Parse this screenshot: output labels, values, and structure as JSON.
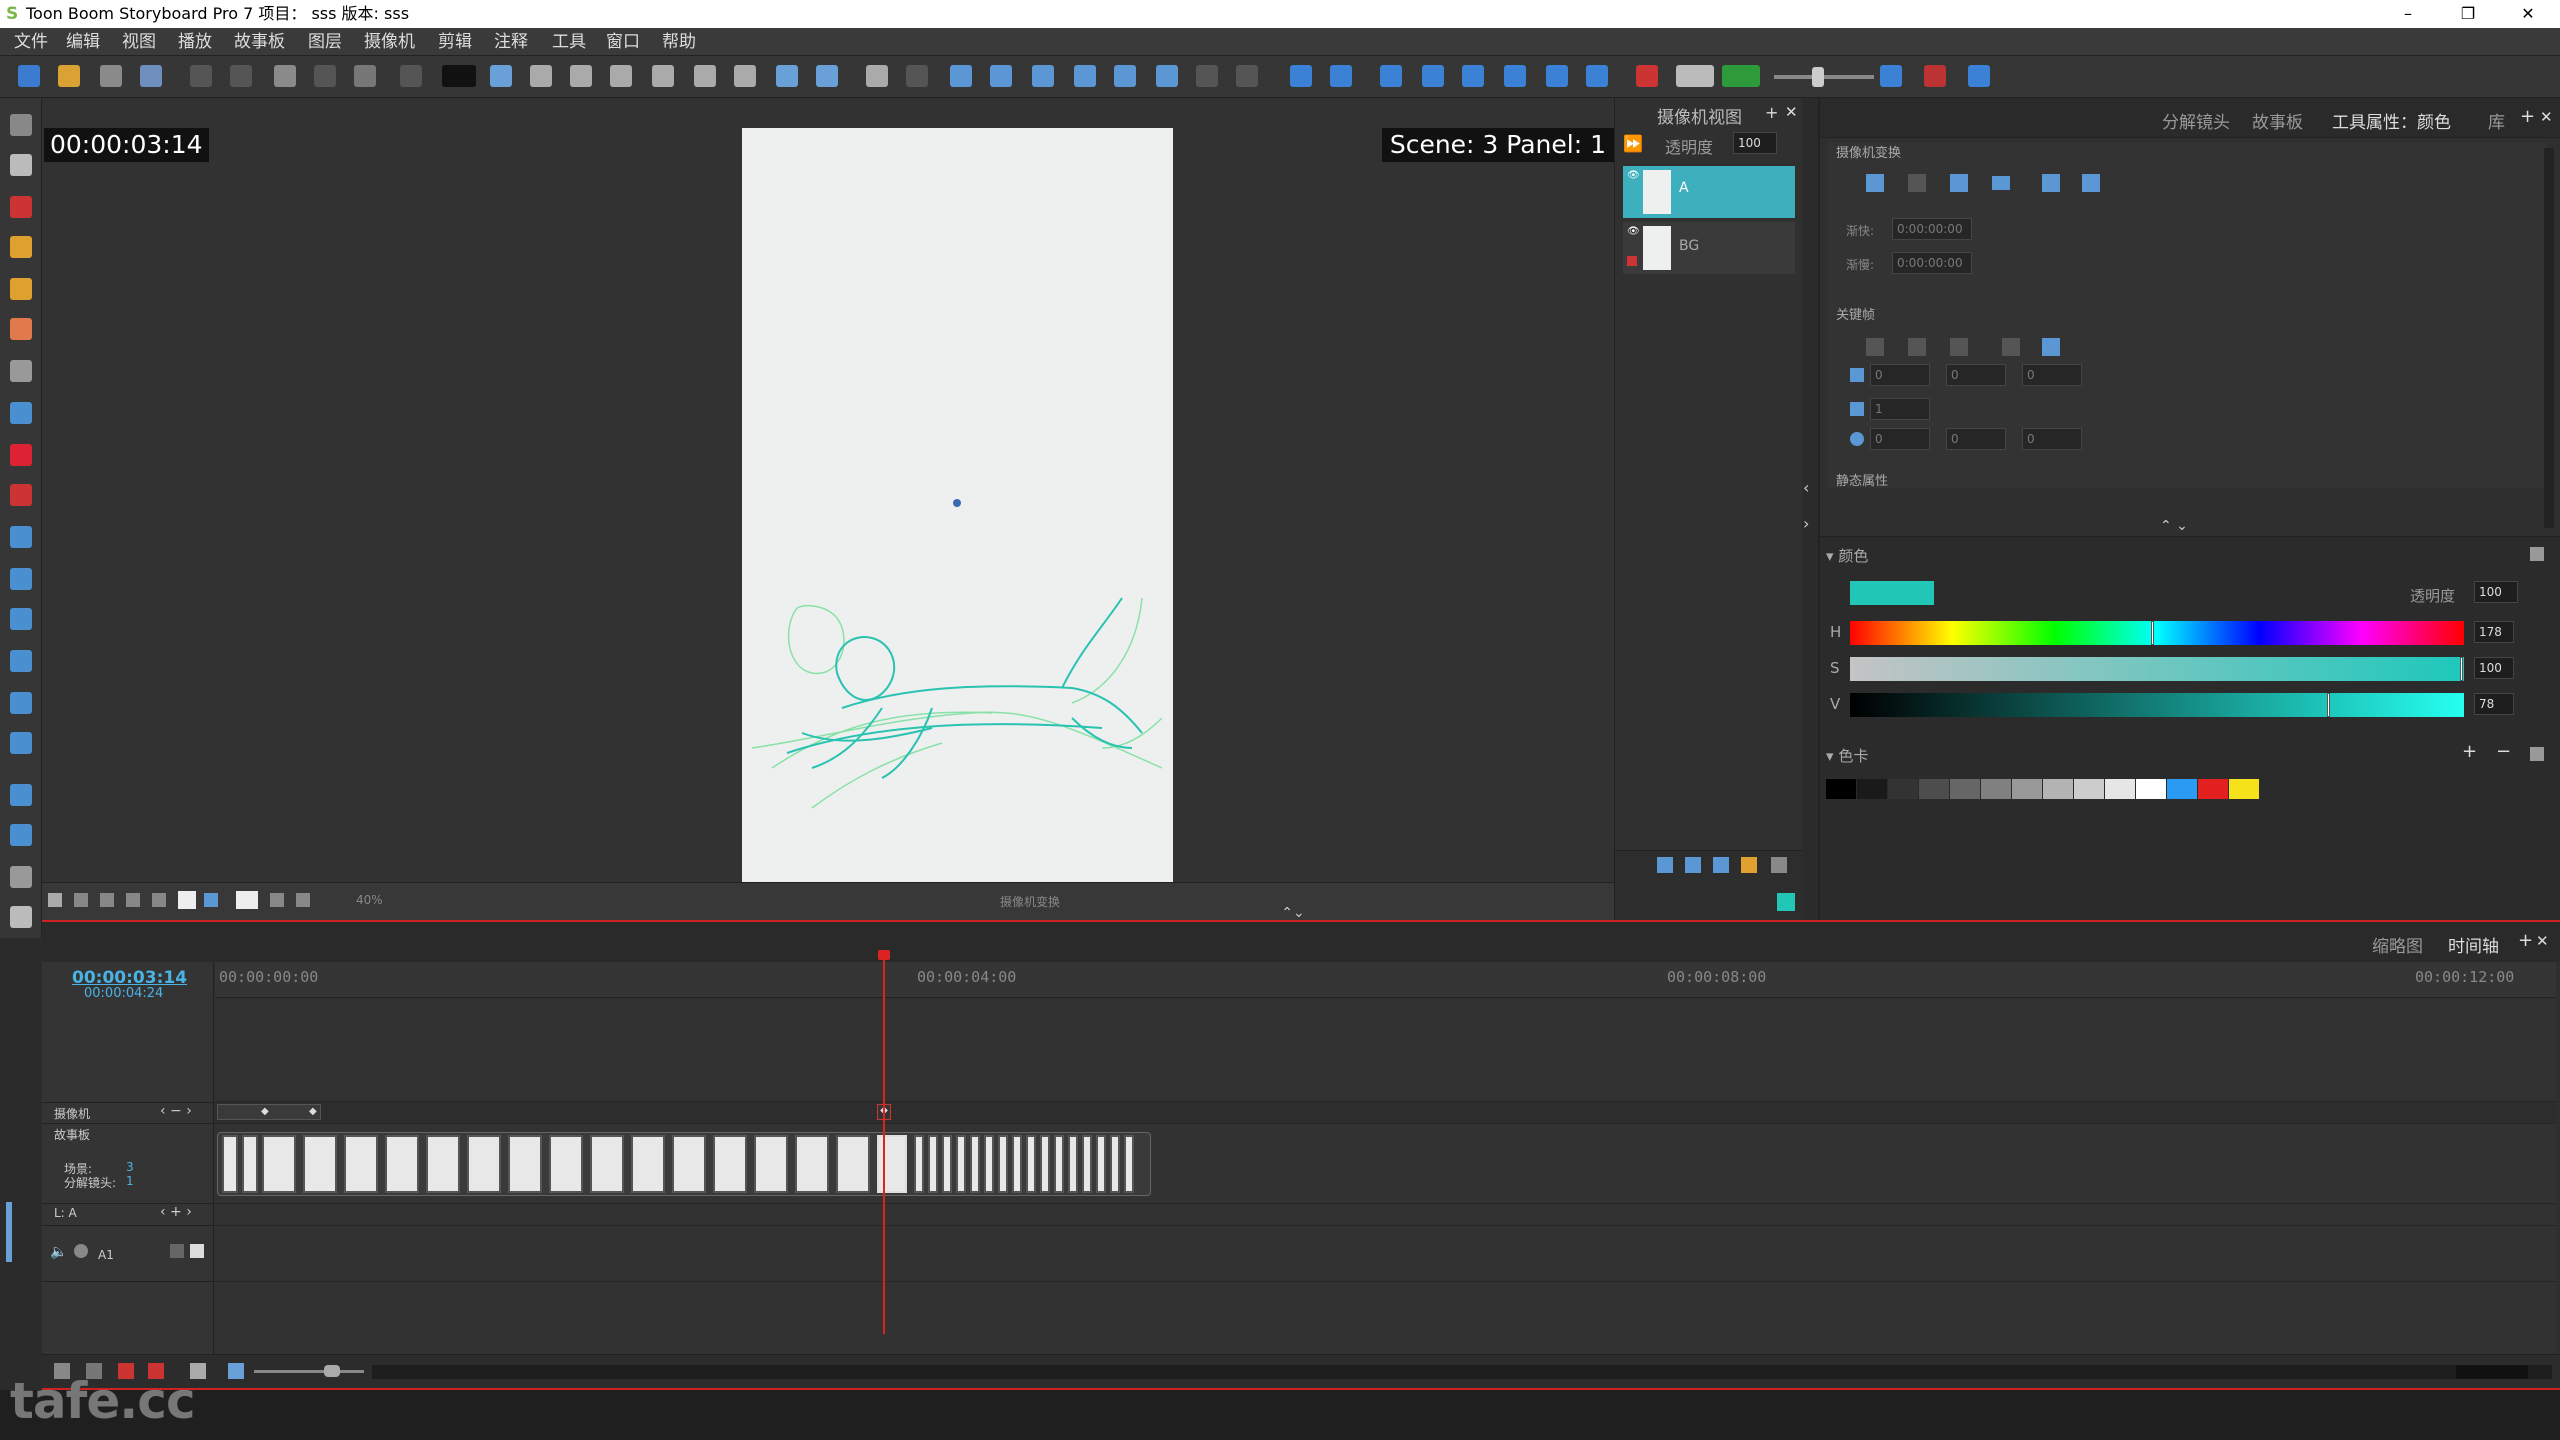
{
  "window": {
    "title": "Toon Boom Storyboard Pro 7 项目： sss 版本: sss",
    "min": "–",
    "max": "❐",
    "close": "✕"
  },
  "menu": [
    "文件",
    "编辑",
    "视图",
    "播放",
    "故事板",
    "图层",
    "摄像机",
    "剪辑",
    "注释",
    "工具",
    "窗口",
    "帮助"
  ],
  "viewer": {
    "timecode": "00:00:03:14",
    "scene_panel": "Scene: 3 Panel: 1",
    "zoom": "40%",
    "mode_label": "摄像机变换"
  },
  "camera_view": {
    "title": "摄像机视图",
    "opacity_label": "透明度",
    "opacity_value": "100",
    "layers": [
      {
        "name": "A",
        "selected": true
      },
      {
        "name": "BG",
        "selected": false
      }
    ]
  },
  "right_tabs": [
    "分解镜头",
    "故事板",
    "工具属性：颜色",
    "库"
  ],
  "tool_props": {
    "cam_transform_label": "摄像机变换",
    "ease_in_label": "渐快:",
    "ease_in_value": "0:00:00:00",
    "ease_out_label": "渐慢:",
    "ease_out_value": "0:00:00:00",
    "keyframe_label": "关键帧",
    "static_label": "静态属性",
    "pos_values": [
      "0",
      "0",
      "0"
    ],
    "scale_value": "1",
    "rot_values": [
      "0",
      "0",
      "0"
    ]
  },
  "color": {
    "section_label": "颜色",
    "opacity_label": "透明度",
    "opacity_value": "100",
    "current_color": "#22c6b7",
    "h_label": "H",
    "h_value": "178",
    "h_fraction": 0.494,
    "s_label": "S",
    "s_value": "100",
    "s_fraction": 1.0,
    "v_label": "V",
    "v_value": "78",
    "v_fraction": 0.78,
    "palette_label": "色卡",
    "palette": [
      "#000000",
      "#1a1a1a",
      "#333333",
      "#4d4d4d",
      "#666666",
      "#808080",
      "#999999",
      "#b3b3b3",
      "#cccccc",
      "#e6e6e6",
      "#ffffff",
      "#2b9af3",
      "#e32020",
      "#f5e21a"
    ]
  },
  "timeline": {
    "current_time": "00:00:03:14",
    "duration": "00:00:04:24",
    "tabs": [
      "缩略图",
      "时间轴"
    ],
    "ruler": [
      "00:00:00:00",
      "00:00:04:00",
      "00:00:08:00",
      "00:00:12:00"
    ],
    "camera_track": "摄像机",
    "storyboard_track": "故事板",
    "scene_label": "场景:",
    "scene_value": "3",
    "panel_label": "分解镜头:",
    "panel_value": "1",
    "layer_track": "L: A",
    "audio_track": "A1"
  },
  "watermark": "tafe.cc"
}
